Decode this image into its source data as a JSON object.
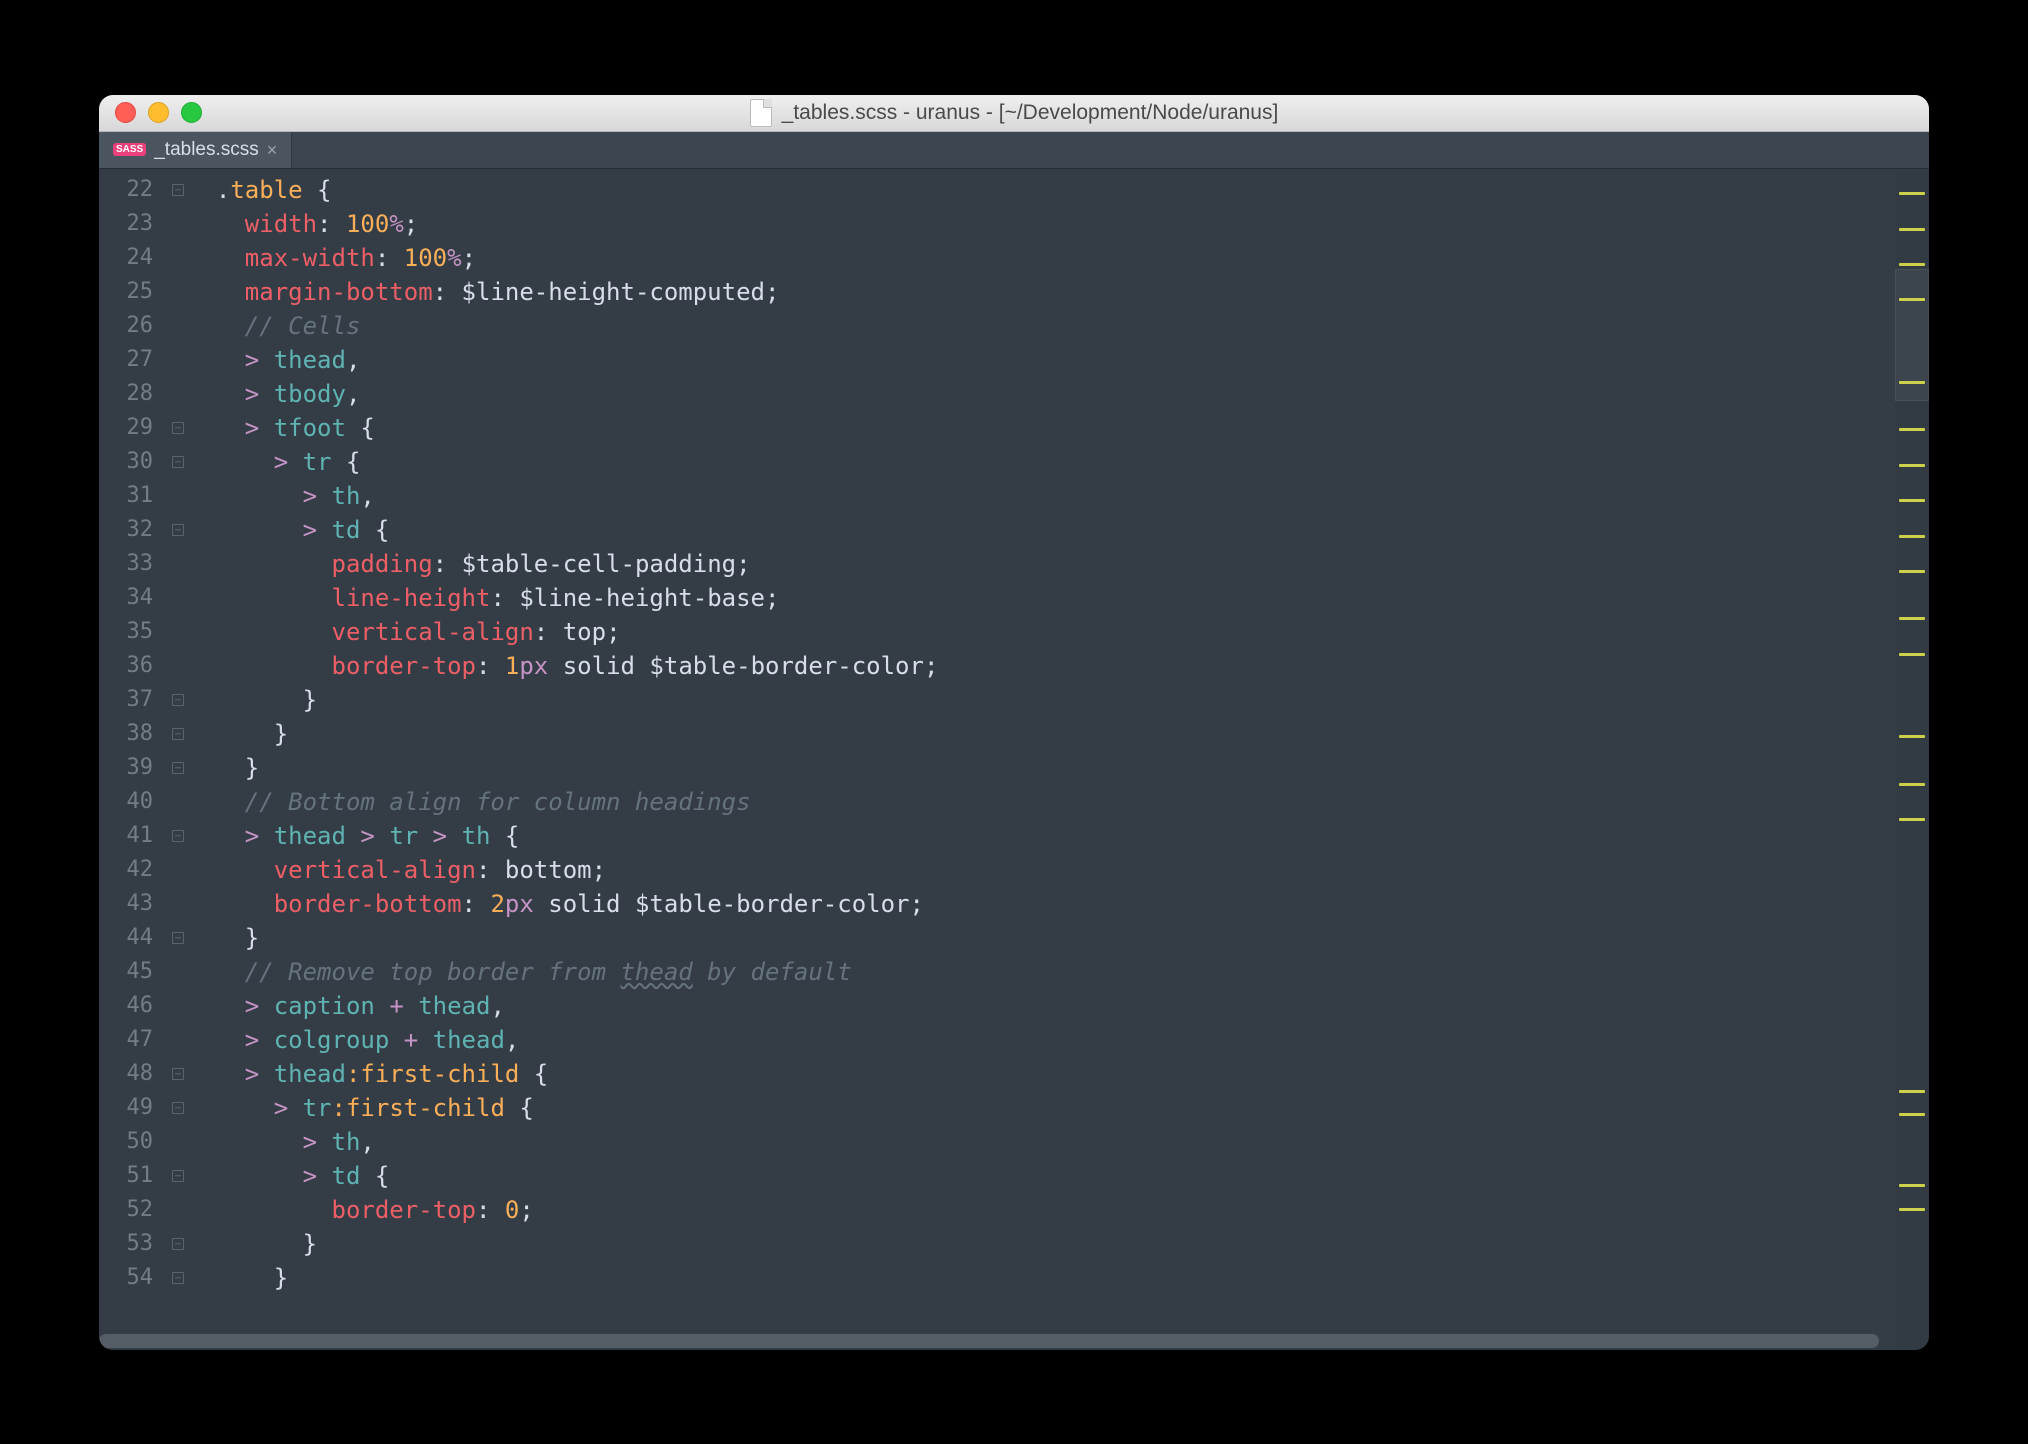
{
  "window": {
    "title": "_tables.scss - uranus - [~/Development/Node/uranus]"
  },
  "tab": {
    "badge": "SASS",
    "filename": "_tables.scss",
    "close": "×"
  },
  "first_line_number": 22,
  "lines": [
    {
      "indent": 0,
      "fold": true,
      "segs": [
        {
          "t": ".",
          "c": "c-punc"
        },
        {
          "t": "table",
          "c": "c-class"
        },
        {
          "t": " {",
          "c": "c-punc"
        }
      ]
    },
    {
      "indent": 1,
      "segs": [
        {
          "t": "width",
          "c": "c-prop"
        },
        {
          "t": ": ",
          "c": "c-punc"
        },
        {
          "t": "100",
          "c": "c-num"
        },
        {
          "t": "%",
          "c": "c-unit"
        },
        {
          "t": ";",
          "c": "c-punc"
        }
      ]
    },
    {
      "indent": 1,
      "segs": [
        {
          "t": "max-width",
          "c": "c-prop"
        },
        {
          "t": ": ",
          "c": "c-punc"
        },
        {
          "t": "100",
          "c": "c-num"
        },
        {
          "t": "%",
          "c": "c-unit"
        },
        {
          "t": ";",
          "c": "c-punc"
        }
      ]
    },
    {
      "indent": 1,
      "segs": [
        {
          "t": "margin-bottom",
          "c": "c-prop"
        },
        {
          "t": ": ",
          "c": "c-punc"
        },
        {
          "t": "$line-height-computed",
          "c": "c-var"
        },
        {
          "t": ";",
          "c": "c-punc"
        }
      ]
    },
    {
      "indent": 1,
      "segs": [
        {
          "t": "// Cells",
          "c": "c-comment"
        }
      ]
    },
    {
      "indent": 1,
      "segs": [
        {
          "t": "> ",
          "c": "c-op"
        },
        {
          "t": "thead",
          "c": "c-tag"
        },
        {
          "t": ",",
          "c": "c-punc"
        }
      ]
    },
    {
      "indent": 1,
      "segs": [
        {
          "t": "> ",
          "c": "c-op"
        },
        {
          "t": "tbody",
          "c": "c-tag"
        },
        {
          "t": ",",
          "c": "c-punc"
        }
      ]
    },
    {
      "indent": 1,
      "fold": true,
      "segs": [
        {
          "t": "> ",
          "c": "c-op"
        },
        {
          "t": "tfoot",
          "c": "c-tag"
        },
        {
          "t": " {",
          "c": "c-punc"
        }
      ]
    },
    {
      "indent": 2,
      "fold": true,
      "segs": [
        {
          "t": "> ",
          "c": "c-op"
        },
        {
          "t": "tr",
          "c": "c-tag"
        },
        {
          "t": " {",
          "c": "c-punc"
        }
      ]
    },
    {
      "indent": 3,
      "segs": [
        {
          "t": "> ",
          "c": "c-op"
        },
        {
          "t": "th",
          "c": "c-tag"
        },
        {
          "t": ",",
          "c": "c-punc"
        }
      ]
    },
    {
      "indent": 3,
      "fold": true,
      "segs": [
        {
          "t": "> ",
          "c": "c-op"
        },
        {
          "t": "td",
          "c": "c-tag"
        },
        {
          "t": " {",
          "c": "c-punc"
        }
      ]
    },
    {
      "indent": 4,
      "segs": [
        {
          "t": "padding",
          "c": "c-prop"
        },
        {
          "t": ": ",
          "c": "c-punc"
        },
        {
          "t": "$table-cell-padding",
          "c": "c-var"
        },
        {
          "t": ";",
          "c": "c-punc"
        }
      ]
    },
    {
      "indent": 4,
      "segs": [
        {
          "t": "line-height",
          "c": "c-prop"
        },
        {
          "t": ": ",
          "c": "c-punc"
        },
        {
          "t": "$line-height-base",
          "c": "c-var"
        },
        {
          "t": ";",
          "c": "c-punc"
        }
      ]
    },
    {
      "indent": 4,
      "segs": [
        {
          "t": "vertical-align",
          "c": "c-prop"
        },
        {
          "t": ": ",
          "c": "c-punc"
        },
        {
          "t": "top",
          "c": "c-var"
        },
        {
          "t": ";",
          "c": "c-punc"
        }
      ]
    },
    {
      "indent": 4,
      "segs": [
        {
          "t": "border-top",
          "c": "c-prop"
        },
        {
          "t": ": ",
          "c": "c-punc"
        },
        {
          "t": "1",
          "c": "c-num"
        },
        {
          "t": "px",
          "c": "c-unit"
        },
        {
          "t": " solid ",
          "c": "c-var"
        },
        {
          "t": "$table-border-color",
          "c": "c-var"
        },
        {
          "t": ";",
          "c": "c-punc"
        }
      ]
    },
    {
      "indent": 3,
      "fold": true,
      "segs": [
        {
          "t": "}",
          "c": "c-punc"
        }
      ]
    },
    {
      "indent": 2,
      "fold": true,
      "segs": [
        {
          "t": "}",
          "c": "c-punc"
        }
      ]
    },
    {
      "indent": 1,
      "fold": true,
      "segs": [
        {
          "t": "}",
          "c": "c-punc"
        }
      ]
    },
    {
      "indent": 1,
      "segs": [
        {
          "t": "// Bottom align for column headings",
          "c": "c-comment"
        }
      ]
    },
    {
      "indent": 1,
      "fold": true,
      "segs": [
        {
          "t": "> ",
          "c": "c-op"
        },
        {
          "t": "thead",
          "c": "c-tag"
        },
        {
          "t": " ",
          "c": "c-punc"
        },
        {
          "t": "> ",
          "c": "c-op"
        },
        {
          "t": "tr",
          "c": "c-tag"
        },
        {
          "t": " ",
          "c": "c-punc"
        },
        {
          "t": "> ",
          "c": "c-op"
        },
        {
          "t": "th",
          "c": "c-tag"
        },
        {
          "t": " {",
          "c": "c-punc"
        }
      ]
    },
    {
      "indent": 2,
      "segs": [
        {
          "t": "vertical-align",
          "c": "c-prop"
        },
        {
          "t": ": ",
          "c": "c-punc"
        },
        {
          "t": "bottom",
          "c": "c-var"
        },
        {
          "t": ";",
          "c": "c-punc"
        }
      ]
    },
    {
      "indent": 2,
      "segs": [
        {
          "t": "border-bottom",
          "c": "c-prop"
        },
        {
          "t": ": ",
          "c": "c-punc"
        },
        {
          "t": "2",
          "c": "c-num"
        },
        {
          "t": "px",
          "c": "c-unit"
        },
        {
          "t": " solid ",
          "c": "c-var"
        },
        {
          "t": "$table-border-color",
          "c": "c-var"
        },
        {
          "t": ";",
          "c": "c-punc"
        }
      ]
    },
    {
      "indent": 1,
      "fold": true,
      "segs": [
        {
          "t": "}",
          "c": "c-punc"
        }
      ]
    },
    {
      "indent": 1,
      "segs": [
        {
          "t": "// Remove top border from ",
          "c": "c-comment"
        },
        {
          "t": "thead",
          "c": "c-comment",
          "squiggle": true
        },
        {
          "t": " by default",
          "c": "c-comment"
        }
      ]
    },
    {
      "indent": 1,
      "segs": [
        {
          "t": "> ",
          "c": "c-op"
        },
        {
          "t": "caption",
          "c": "c-tag"
        },
        {
          "t": " ",
          "c": "c-punc"
        },
        {
          "t": "+ ",
          "c": "c-op"
        },
        {
          "t": "thead",
          "c": "c-tag"
        },
        {
          "t": ",",
          "c": "c-punc"
        }
      ]
    },
    {
      "indent": 1,
      "segs": [
        {
          "t": "> ",
          "c": "c-op"
        },
        {
          "t": "colgroup",
          "c": "c-tag"
        },
        {
          "t": " ",
          "c": "c-punc"
        },
        {
          "t": "+ ",
          "c": "c-op"
        },
        {
          "t": "thead",
          "c": "c-tag"
        },
        {
          "t": ",",
          "c": "c-punc"
        }
      ]
    },
    {
      "indent": 1,
      "fold": true,
      "segs": [
        {
          "t": "> ",
          "c": "c-op"
        },
        {
          "t": "thead",
          "c": "c-tag"
        },
        {
          "t": ":first-child",
          "c": "c-pseudo"
        },
        {
          "t": " {",
          "c": "c-punc"
        }
      ]
    },
    {
      "indent": 2,
      "fold": true,
      "segs": [
        {
          "t": "> ",
          "c": "c-op"
        },
        {
          "t": "tr",
          "c": "c-tag"
        },
        {
          "t": ":first-child",
          "c": "c-pseudo"
        },
        {
          "t": " {",
          "c": "c-punc"
        }
      ]
    },
    {
      "indent": 3,
      "segs": [
        {
          "t": "> ",
          "c": "c-op"
        },
        {
          "t": "th",
          "c": "c-tag"
        },
        {
          "t": ",",
          "c": "c-punc"
        }
      ]
    },
    {
      "indent": 3,
      "fold": true,
      "segs": [
        {
          "t": "> ",
          "c": "c-op"
        },
        {
          "t": "td",
          "c": "c-tag"
        },
        {
          "t": " {",
          "c": "c-punc"
        }
      ]
    },
    {
      "indent": 4,
      "segs": [
        {
          "t": "border-top",
          "c": "c-prop"
        },
        {
          "t": ": ",
          "c": "c-punc"
        },
        {
          "t": "0",
          "c": "c-num"
        },
        {
          "t": ";",
          "c": "c-punc"
        }
      ]
    },
    {
      "indent": 3,
      "fold": true,
      "segs": [
        {
          "t": "}",
          "c": "c-punc"
        }
      ]
    },
    {
      "indent": 2,
      "fold": true,
      "segs": [
        {
          "t": "}",
          "c": "c-punc"
        }
      ]
    }
  ],
  "minimap_bars_pct": [
    2,
    5,
    8,
    11,
    18,
    22,
    25,
    28,
    31,
    34,
    38,
    41,
    48,
    52,
    55,
    78,
    80,
    86,
    88
  ]
}
